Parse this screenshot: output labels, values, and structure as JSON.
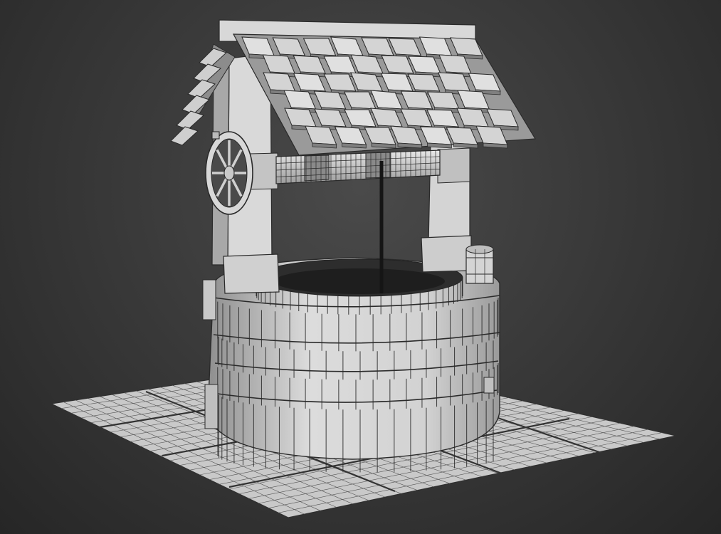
{
  "viewport": {
    "shading": "wireframe-on-shaded",
    "background_color": "#3b3b3b",
    "object_color": "#d6d6d6",
    "wire_color": "#2a2a2a",
    "rope_color": "#1a1a1a"
  },
  "scene": {
    "objects": [
      "ground-tiles",
      "stone-well-ring",
      "left-post",
      "right-post",
      "windlass-drum",
      "crank-wheel",
      "shingle-roof",
      "rope",
      "bucket"
    ]
  }
}
